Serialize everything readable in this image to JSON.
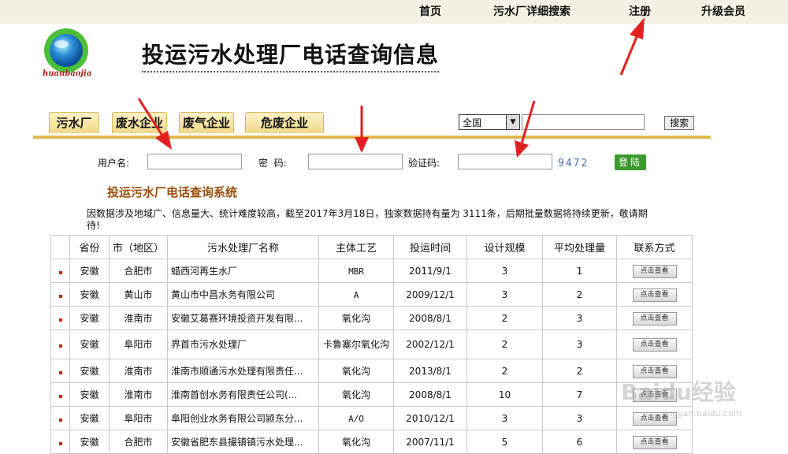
{
  "nav": {
    "home": "首页",
    "detailed_search": "污水厂详细搜索",
    "register": "注册",
    "upgrade": "升级会员"
  },
  "logo_text": "huanbaojia",
  "page_title": "投运污水处理厂电话查询信息",
  "tabs": [
    "污水厂",
    "废水企业",
    "废气企业",
    "危废企业"
  ],
  "search": {
    "region_selected": "全国",
    "button_label": "搜索"
  },
  "login": {
    "username_label": "用户名:",
    "password_label": "密  码:",
    "captcha_label": "验证码:",
    "captcha_value": "9472",
    "login_button": "登陆"
  },
  "system_title": "投运污水厂电话查询系统",
  "notice": "因数据涉及地域广、信息量大、统计难度较高，截至2017年3月18日，独家数据持有量为 3111条，后期批量数据将持续更新，敬请期待!",
  "table": {
    "headers": [
      "",
      "省份",
      "市（地区）",
      "污水处理厂名称",
      "主体工艺",
      "投运时间",
      "设计规模",
      "平均处理量",
      "联系方式"
    ],
    "view_button": "点击查看",
    "rows": [
      {
        "province": "安徽",
        "city": "合肥市",
        "name": "蜡西河再生水厂",
        "process": "MBR",
        "date": "2011/9/1",
        "design": "3",
        "avg": "1"
      },
      {
        "province": "安徽",
        "city": "黄山市",
        "name": "黄山市中昌水务有限公司",
        "process": "A",
        "date": "2009/12/1",
        "design": "3",
        "avg": "2"
      },
      {
        "province": "安徽",
        "city": "淮南市",
        "name": "安徽艾葛赛环境投资开发有限...",
        "process": "氧化沟",
        "date": "2008/8/1",
        "design": "2",
        "avg": "3"
      },
      {
        "province": "安徽",
        "city": "阜阳市",
        "name": "界首市污水处理厂",
        "process": "卡鲁塞尔氧化沟",
        "date": "2002/12/1",
        "design": "2",
        "avg": "3"
      },
      {
        "province": "安徽",
        "city": "淮南市",
        "name": "淮南市顺通污水处理有限责任...",
        "process": "氧化沟",
        "date": "2013/8/1",
        "design": "2",
        "avg": "2"
      },
      {
        "province": "安徽",
        "city": "淮南市",
        "name": "淮南首创水务有限责任公司(...",
        "process": "氧化沟",
        "date": "2008/8/1",
        "design": "10",
        "avg": "7"
      },
      {
        "province": "安徽",
        "city": "阜阳市",
        "name": "阜阳创业水务有限公司颍东分...",
        "process": "A/O",
        "date": "2010/12/1",
        "design": "3",
        "avg": "3"
      },
      {
        "province": "安徽",
        "city": "合肥市",
        "name": "安徽省肥东县撮镇镇污水处理...",
        "process": "氧化沟",
        "date": "2007/11/1",
        "design": "5",
        "avg": "6"
      }
    ]
  },
  "watermark": "Baidu经验",
  "watermark_sub": "jingyan.baidu.com",
  "colors": {
    "accent_gold": "#e3b74e",
    "login_green": "#3a9a2c",
    "title_brown": "#9a4d0a",
    "bullet_red": "#d61a1a",
    "arrow_red": "#e02020"
  }
}
